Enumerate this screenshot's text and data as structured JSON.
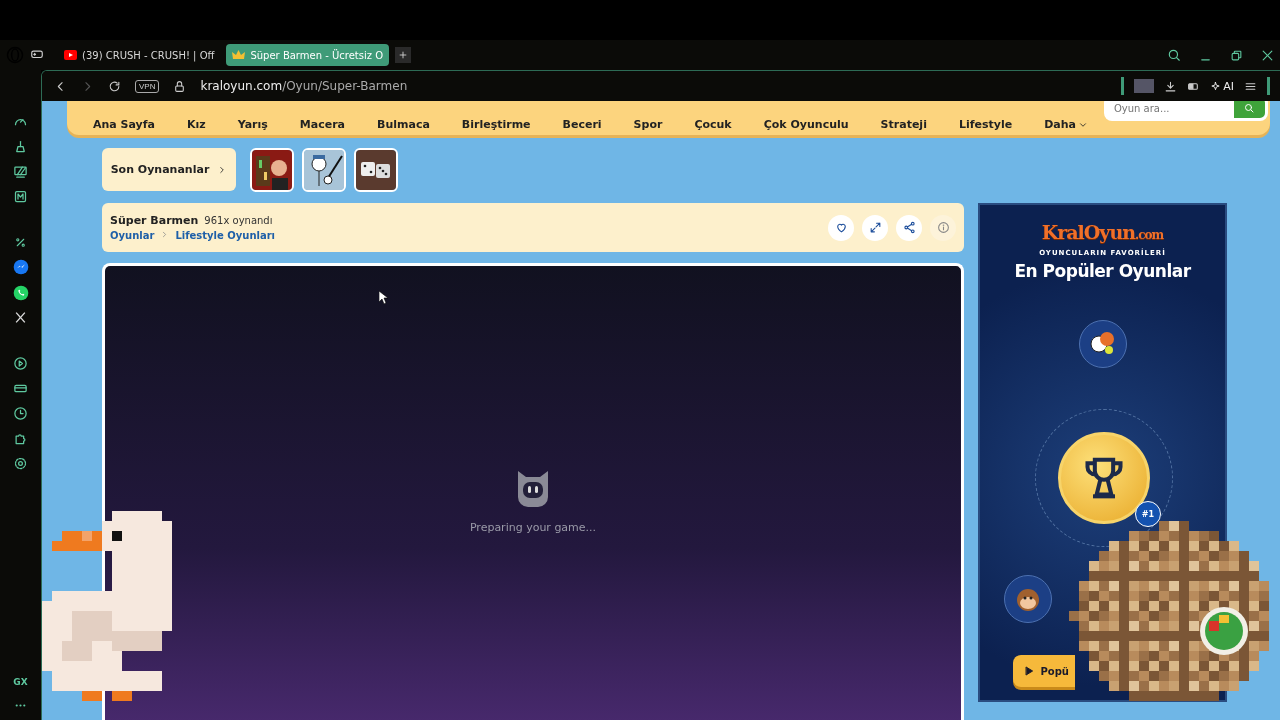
{
  "browser": {
    "tabs": [
      {
        "kind": "video",
        "title": "(39) CRUSH - CRUSH! | Off",
        "selected": false
      },
      {
        "kind": "crown",
        "title": "Süper Barmen - Ücretsiz O",
        "selected": true
      }
    ],
    "address": {
      "vpn": "VPN",
      "domain": "kraloyun.com",
      "path": "/Oyun/Super-Barmen"
    },
    "ai_label": "AI",
    "sidebar_label": "GX"
  },
  "nav": {
    "items": [
      "Ana Sayfa",
      "Kız",
      "Yarış",
      "Macera",
      "Bulmaca",
      "Birleştirme",
      "Beceri",
      "Spor",
      "Çocuk",
      "Çok Oyunculu",
      "Strateji",
      "Lifestyle"
    ],
    "more": "Daha",
    "search_placeholder": "Oyun ara..."
  },
  "recent": {
    "label": "Son Oynananlar",
    "thumbnails": [
      {
        "kind": "bar"
      },
      {
        "kind": "stickman"
      },
      {
        "kind": "dice"
      }
    ]
  },
  "game": {
    "title": "Süper Barmen",
    "plays": "961x oynandı",
    "breadcrumb": [
      "Oyunlar",
      "Lifestyle Oyunları"
    ],
    "loading": "Preparing your game..."
  },
  "ad": {
    "logo": "KralOyun",
    "logo_suffix": ".com",
    "subtitle": "OYUNCULARIN FAVORİLERİ",
    "title": "En Popüler Oyunlar",
    "badge": "#1",
    "button": "Popü"
  }
}
